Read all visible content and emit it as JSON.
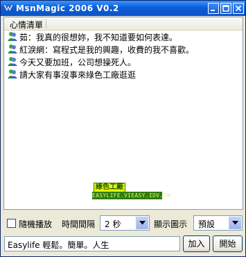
{
  "window": {
    "title": "MsnMagic 2006 V0.2",
    "icon": "msnmagic-app-icon"
  },
  "list": {
    "column_header": "心情清單",
    "items": [
      {
        "text": "茹：我真的很想妳，我不知道要如何表達。",
        "icon": "msn-buddy-icon"
      },
      {
        "text": "紅淚網：寫程式是我的興趣，收費的我不喜歡。",
        "icon": "msn-buddy-icon"
      },
      {
        "text": "今天又要加班，公司想操死人。",
        "icon": "msn-buddy-icon"
      },
      {
        "text": "請大家有事沒事來綠色工廠逛逛",
        "icon": "msn-buddy-icon"
      }
    ]
  },
  "watermark": {
    "top": "綠色工廠",
    "bottom": "EASYLIFE.VIEASY.IDV.TW"
  },
  "controls": {
    "random_play_label": "隨機播放",
    "random_play_checked": false,
    "interval_label": "時間間隔",
    "interval_value": "2 秒",
    "display_icon_label": "顯示圖示",
    "display_icon_value": "預設"
  },
  "bottom": {
    "input_value": "Easylife 輕鬆。簡單。人生",
    "add_label": "加入",
    "start_label": "開始"
  }
}
